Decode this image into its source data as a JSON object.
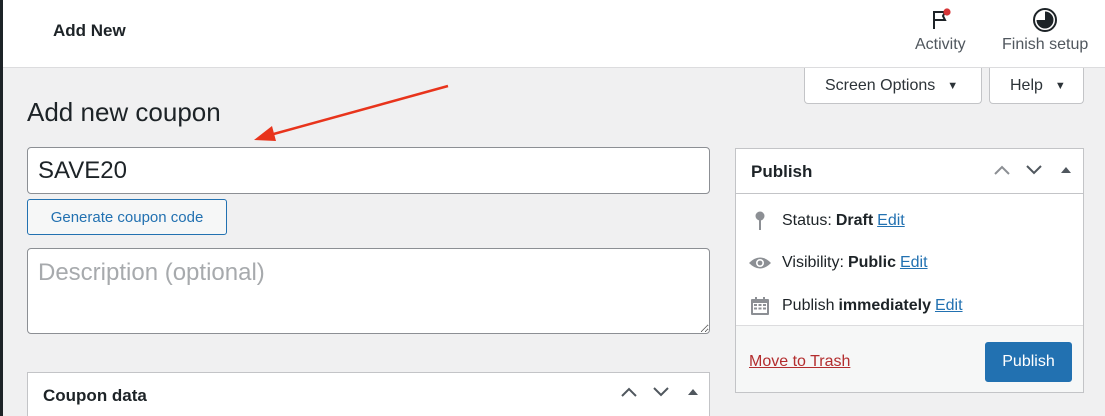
{
  "topbar": {
    "title": "Add New",
    "activity_label": "Activity",
    "finish_label": "Finish setup"
  },
  "header_buttons": {
    "screen_options": "Screen Options",
    "help": "Help"
  },
  "page": {
    "title": "Add new coupon",
    "coupon_code": "SAVE20",
    "generate_label": "Generate coupon code",
    "description_placeholder": "Description (optional)"
  },
  "publish": {
    "title": "Publish",
    "status_label": "Status:",
    "status_value": "Draft",
    "visibility_label": "Visibility:",
    "visibility_value": "Public",
    "publish_label": "Publish",
    "publish_value": "immediately",
    "edit": "Edit",
    "trash": "Move to Trash",
    "button": "Publish"
  },
  "coupon_data": {
    "title": "Coupon data"
  },
  "colors": {
    "accent": "#2271b1",
    "danger": "#b32d2e",
    "annotation_arrow": "#e8341c"
  },
  "icons": [
    "flag-icon",
    "progress-circle-icon",
    "pin-icon",
    "eye-icon",
    "calendar-icon",
    "chevron-up-icon",
    "chevron-down-icon",
    "caret-up-icon"
  ]
}
